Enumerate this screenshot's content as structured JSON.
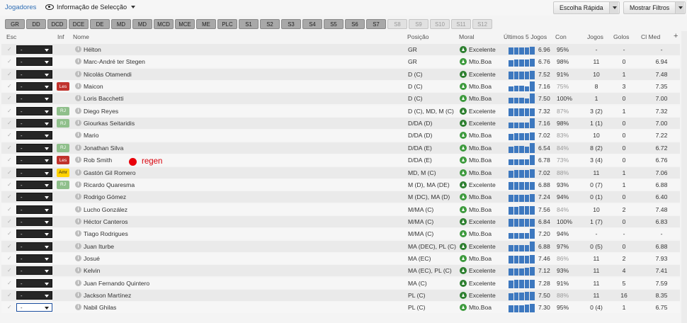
{
  "header": {
    "title": "Jogadores",
    "view_label": "Informação de Selecção",
    "quick_pick": "Escolha Rápida",
    "filters": "Mostrar Filtros"
  },
  "chips": [
    {
      "label": "GR",
      "on": true
    },
    {
      "label": "DD",
      "on": true
    },
    {
      "label": "DCD",
      "on": true
    },
    {
      "label": "DCE",
      "on": true
    },
    {
      "label": "DE",
      "on": true
    },
    {
      "label": "MD",
      "on": true
    },
    {
      "label": "MD",
      "on": true
    },
    {
      "label": "MCD",
      "on": true
    },
    {
      "label": "MCE",
      "on": true
    },
    {
      "label": "ME",
      "on": true
    },
    {
      "label": "PLC",
      "on": true
    },
    {
      "label": "S1",
      "on": true
    },
    {
      "label": "S2",
      "on": true
    },
    {
      "label": "S3",
      "on": true
    },
    {
      "label": "S4",
      "on": true
    },
    {
      "label": "S5",
      "on": true
    },
    {
      "label": "S6",
      "on": true
    },
    {
      "label": "S7",
      "on": true
    },
    {
      "label": "S8",
      "on": false
    },
    {
      "label": "S9",
      "on": false
    },
    {
      "label": "S10",
      "on": false
    },
    {
      "label": "S11",
      "on": false
    },
    {
      "label": "S12",
      "on": false
    }
  ],
  "columns": {
    "esc": "Esc",
    "inf": "Inf",
    "nome": "Nome",
    "posicao": "Posição",
    "moral": "Moral",
    "ultimos": "Últimos 5 Jogos",
    "con": "Con",
    "jogos": "Jogos",
    "golos": "Golos",
    "clmed": "Cl Med",
    "add": "+"
  },
  "players": [
    {
      "sel": "-",
      "tag": "",
      "name": "Hélton",
      "pos": "GR",
      "moral": "Excelente",
      "form": [
        0.7,
        0.75,
        0.75,
        0.75,
        0.8
      ],
      "rating": "6.96",
      "con": "95%",
      "jogos": "-",
      "golos": "-",
      "clmed": "-"
    },
    {
      "sel": "-",
      "tag": "",
      "name": "Marc-André ter Stegen",
      "pos": "GR",
      "moral": "Mto.Boa",
      "form": [
        0.7,
        0.75,
        0.75,
        0.75,
        0.8
      ],
      "rating": "6.76",
      "con": "98%",
      "jogos": "11",
      "golos": "0",
      "clmed": "6.94"
    },
    {
      "sel": "-",
      "tag": "",
      "name": "Nicolás Otamendi",
      "pos": "D (C)",
      "moral": "Excelente",
      "form": [
        0.75,
        0.75,
        0.8,
        0.8,
        0.85
      ],
      "rating": "7.52",
      "con": "91%",
      "jogos": "10",
      "golos": "1",
      "clmed": "7.48"
    },
    {
      "sel": "-",
      "tag": "Les",
      "name": "Maicon",
      "pos": "D (C)",
      "moral": "Mto.Boa",
      "form": [
        0.5,
        0.6,
        0.6,
        0.5,
        1.0
      ],
      "rating": "7.16",
      "con": "75%",
      "jogos": "8",
      "golos": "3",
      "clmed": "7.35"
    },
    {
      "sel": "-",
      "tag": "",
      "name": "Loris Bacchetti",
      "pos": "D (C)",
      "moral": "Mto.Boa",
      "form": [
        0.6,
        0.6,
        0.6,
        0.5,
        1.0
      ],
      "rating": "7.50",
      "con": "100%",
      "jogos": "1",
      "golos": "0",
      "clmed": "7.00"
    },
    {
      "sel": "-",
      "tag": "RJ",
      "name": "Diego Reyes",
      "pos": "D (C), MD, M (C)",
      "moral": "Excelente",
      "form": [
        0.75,
        0.75,
        0.75,
        0.8,
        0.8
      ],
      "rating": "7.32",
      "con": "87%",
      "jogos": "3 (2)",
      "golos": "1",
      "clmed": "7.32"
    },
    {
      "sel": "-",
      "tag": "RJ",
      "name": "Giourkas Seitaridis",
      "pos": "D/DA (D)",
      "moral": "Excelente",
      "form": [
        0.6,
        0.6,
        0.6,
        0.6,
        1.0
      ],
      "rating": "7.16",
      "con": "98%",
      "jogos": "1 (1)",
      "golos": "0",
      "clmed": "7.00"
    },
    {
      "sel": "-",
      "tag": "",
      "name": "Mario",
      "pos": "D/DA (D)",
      "moral": "Mto.Boa",
      "form": [
        0.7,
        0.75,
        0.75,
        0.75,
        0.8
      ],
      "rating": "7.02",
      "con": "83%",
      "jogos": "10",
      "golos": "0",
      "clmed": "7.22"
    },
    {
      "sel": "-",
      "tag": "RJ",
      "name": "Jonathan Silva",
      "pos": "D/DA (E)",
      "moral": "Mto.Boa",
      "form": [
        0.6,
        0.7,
        0.7,
        0.6,
        1.0
      ],
      "rating": "6.54",
      "con": "84%",
      "jogos": "8 (2)",
      "golos": "0",
      "clmed": "6.72"
    },
    {
      "sel": "-",
      "tag": "Les",
      "name": "Rob Smith",
      "pos": "D/DA (E)",
      "moral": "Mto.Boa",
      "form": [
        0.6,
        0.6,
        0.6,
        0.6,
        1.0
      ],
      "rating": "6.78",
      "con": "73%",
      "jogos": "3 (4)",
      "golos": "0",
      "clmed": "6.76"
    },
    {
      "sel": "-",
      "tag": "Amr",
      "name": "Gastón Gil Romero",
      "pos": "MD, M (C)",
      "moral": "Mto.Boa",
      "form": [
        0.7,
        0.75,
        0.75,
        0.75,
        0.8
      ],
      "rating": "7.02",
      "con": "88%",
      "jogos": "11",
      "golos": "1",
      "clmed": "7.06"
    },
    {
      "sel": "-",
      "tag": "RJ",
      "name": "Ricardo Quaresma",
      "pos": "M (D), MA (DE)",
      "moral": "Excelente",
      "form": [
        0.75,
        0.75,
        0.8,
        0.8,
        0.8
      ],
      "rating": "6.88",
      "con": "93%",
      "jogos": "0 (7)",
      "golos": "1",
      "clmed": "6.88"
    },
    {
      "sel": "-",
      "tag": "",
      "name": "Rodrigo Gómez",
      "pos": "M (DC), MA (D)",
      "moral": "Mto.Boa",
      "form": [
        0.7,
        0.75,
        0.75,
        0.75,
        0.8
      ],
      "rating": "7.24",
      "con": "94%",
      "jogos": "0 (1)",
      "golos": "0",
      "clmed": "6.40"
    },
    {
      "sel": "-",
      "tag": "",
      "name": "Lucho González",
      "pos": "M/MA (C)",
      "moral": "Mto.Boa",
      "form": [
        0.75,
        0.75,
        0.8,
        0.8,
        0.8
      ],
      "rating": "7.56",
      "con": "84%",
      "jogos": "10",
      "golos": "2",
      "clmed": "7.48"
    },
    {
      "sel": "-",
      "tag": "",
      "name": "Héctor Canteros",
      "pos": "M/MA (C)",
      "moral": "Excelente",
      "form": [
        0.75,
        0.75,
        0.75,
        0.8,
        0.8
      ],
      "rating": "6.84",
      "con": "100%",
      "jogos": "1 (7)",
      "golos": "0",
      "clmed": "6.83"
    },
    {
      "sel": "-",
      "tag": "",
      "name": "Tiago Rodrigues",
      "pos": "M/MA (C)",
      "moral": "Mto.Boa",
      "form": [
        0.6,
        0.6,
        0.6,
        0.6,
        1.0
      ],
      "rating": "7.20",
      "con": "94%",
      "jogos": "-",
      "golos": "-",
      "clmed": "-"
    },
    {
      "sel": "-",
      "tag": "",
      "name": "Juan Iturbe",
      "pos": "MA (DEC), PL (C)",
      "moral": "Excelente",
      "form": [
        0.6,
        0.6,
        0.6,
        0.6,
        1.0
      ],
      "rating": "6.88",
      "con": "97%",
      "jogos": "0 (5)",
      "golos": "0",
      "clmed": "6.88"
    },
    {
      "sel": "-",
      "tag": "",
      "name": "Josué",
      "pos": "MA (EC)",
      "moral": "Mto.Boa",
      "form": [
        0.75,
        0.8,
        0.8,
        0.8,
        0.85
      ],
      "rating": "7.46",
      "con": "86%",
      "jogos": "11",
      "golos": "2",
      "clmed": "7.93"
    },
    {
      "sel": "-",
      "tag": "",
      "name": "Kelvin",
      "pos": "MA (EC), PL (C)",
      "moral": "Excelente",
      "form": [
        0.75,
        0.75,
        0.75,
        0.8,
        0.85
      ],
      "rating": "7.12",
      "con": "93%",
      "jogos": "11",
      "golos": "4",
      "clmed": "7.41"
    },
    {
      "sel": "-",
      "tag": "",
      "name": "Juan Fernando Quintero",
      "pos": "MA (C)",
      "moral": "Excelente",
      "form": [
        0.75,
        0.8,
        0.8,
        0.8,
        0.85
      ],
      "rating": "7.28",
      "con": "91%",
      "jogos": "11",
      "golos": "5",
      "clmed": "7.59"
    },
    {
      "sel": "-",
      "tag": "",
      "name": "Jackson Martínez",
      "pos": "PL (C)",
      "moral": "Excelente",
      "form": [
        0.75,
        0.8,
        0.8,
        0.85,
        0.85
      ],
      "rating": "7.50",
      "con": "88%",
      "jogos": "11",
      "golos": "16",
      "clmed": "8.35"
    },
    {
      "sel": "-",
      "tag": "",
      "name": "Nabil Ghilas",
      "pos": "PL (C)",
      "moral": "Mto.Boa",
      "form": [
        0.75,
        0.75,
        0.75,
        0.8,
        0.85
      ],
      "rating": "7.30",
      "con": "95%",
      "jogos": "0 (4)",
      "golos": "1",
      "clmed": "6.75"
    }
  ],
  "annotation": {
    "text": "regen",
    "color": "#e8000a"
  },
  "colors": {
    "accent": "#2f6eb5",
    "form_bar": "#3d78bf",
    "moral_green": "#2d7f2f"
  }
}
